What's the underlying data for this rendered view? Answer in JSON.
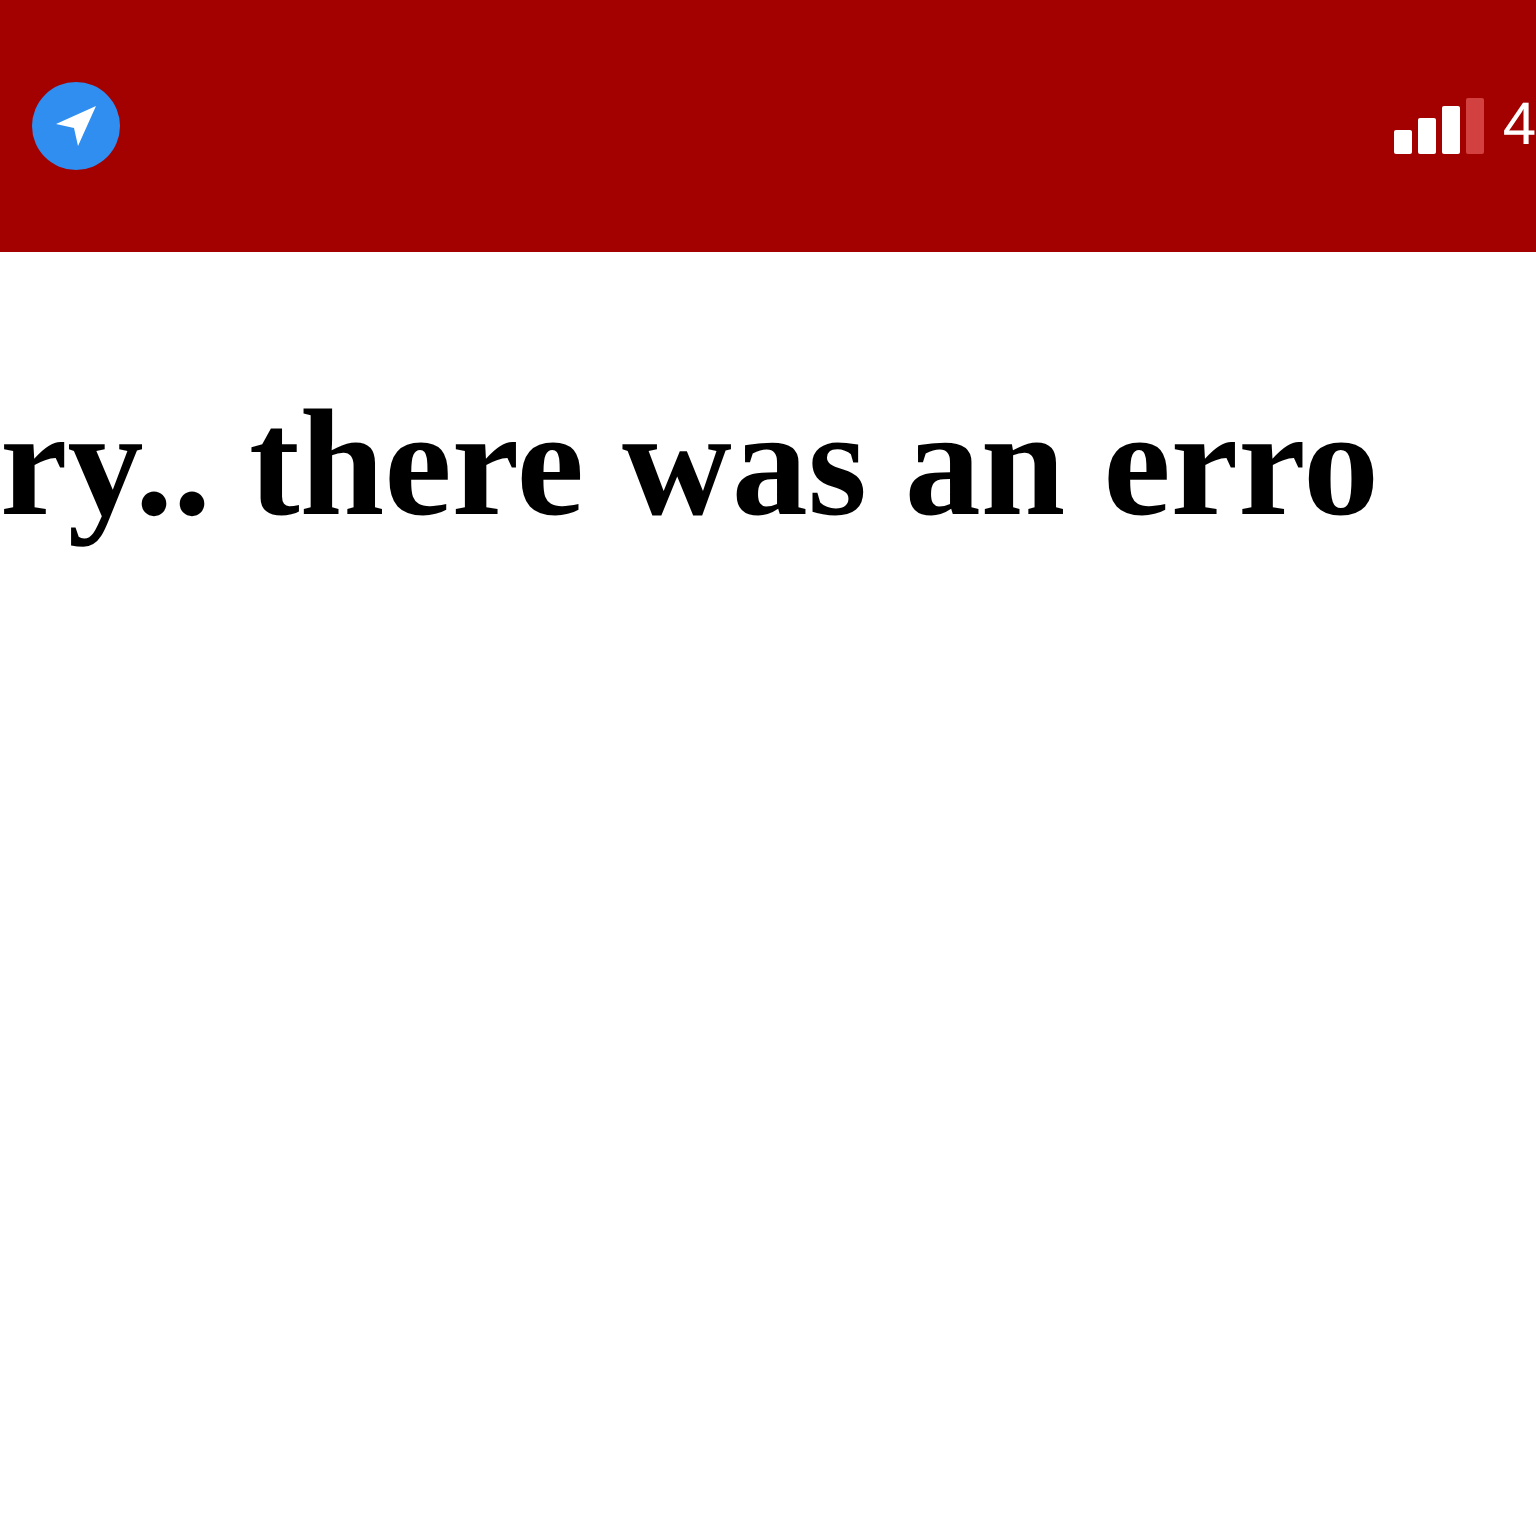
{
  "status_bar": {
    "text": "4"
  },
  "message": {
    "text": "ry.. there was an erro"
  }
}
